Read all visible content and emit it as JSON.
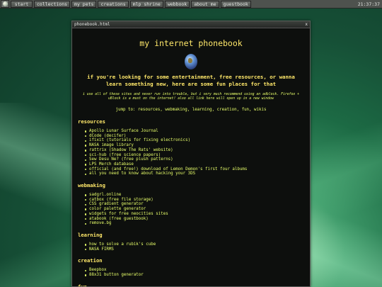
{
  "taskbar": {
    "start": "start",
    "buttons": [
      "collections",
      "my pets",
      "creations",
      "mlp shrine",
      "webbook",
      "about me",
      "guestbook"
    ],
    "clock": "21:37:37"
  },
  "window": {
    "title": "phonebook.html",
    "close": "x"
  },
  "page": {
    "title": "my internet phonebook",
    "intro": "if you're looking for some entertainment, free resources, or wanna learn something new, here are some fun places for that",
    "note": "i use all of these sites and never run into trouble, but i very much recommend using an adblock. Firefox + uBlock is a must on the internet! also all link here will open up in a new window",
    "jump_prefix": "jump to:",
    "jump_links": [
      "resources,",
      "webmaking,",
      "learning,",
      "creation,",
      "fun,",
      "wikis"
    ]
  },
  "sections": {
    "resources": {
      "title": "resources",
      "items": [
        "Apollo Lunar Surface Journal",
        "dCode (decifer)",
        "ifixit (tutorials for fixing electronics)",
        "NASA image library",
        "rattrix (Shadow The Rats' website)",
        "sci-hub (free science papers)",
        "Sew Desu Ne? (free plush patterns)",
        "LPS Merch database",
        "official (and free!) download of Lemon Demon's first four albums",
        "all you need to know about hacking your 3DS"
      ]
    },
    "webmaking": {
      "title": "webmaking",
      "items": [
        "sadgrl.online",
        "catbox (free file storage)",
        "CSS gradient generator",
        "color palette generator",
        "widgets for free neocities sites",
        "atabook (free guestbook)",
        "remove.bg"
      ]
    },
    "learning": {
      "title": "learning",
      "items": [
        "how to solve a rubik's cube",
        "NASA FIRMS"
      ]
    },
    "creation": {
      "title": "creation",
      "items": [
        "Beepbox",
        "88x31 button generator"
      ]
    },
    "fun": {
      "title": "fun"
    }
  }
}
